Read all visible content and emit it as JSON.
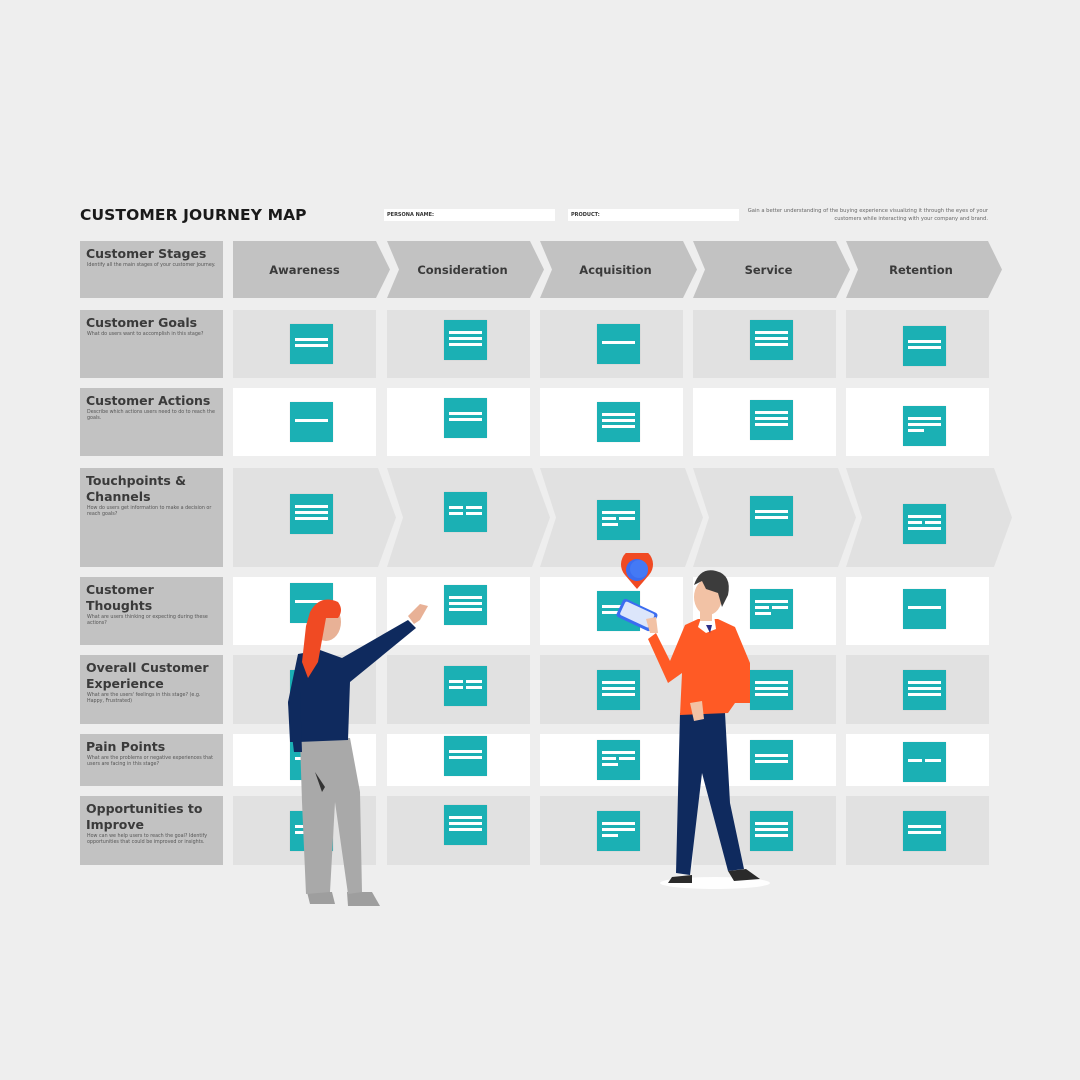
{
  "header": {
    "title": "CUSTOMER JOURNEY MAP",
    "persona_label": "PERSONA NAME:",
    "persona_value": "",
    "product_label": "PRODUCT:",
    "product_value": "",
    "intro": "Gain a better understanding of the buying experience visualizing it through the eyes of your customers while interacting with your company and brand."
  },
  "colors": {
    "note": "#1bb0b4",
    "label_bg": "#c2c2c2",
    "cell_gray": "#e1e1e1",
    "cell_white": "#ffffff",
    "page_bg": "#eeeeee"
  },
  "stages": [
    "Awareness",
    "Consideration",
    "Acquisition",
    "Service",
    "Retention"
  ],
  "rows": [
    {
      "label": "Customer Stages",
      "desc": "Identify all the main stages of your customer journey."
    },
    {
      "label": "Customer Goals",
      "desc": "What do users want to accomplish in this stage?"
    },
    {
      "label": "Customer Actions",
      "desc": "Describe which actions users need to do to reach the goals."
    },
    {
      "label": "Touchpoints & Channels",
      "desc": "How do users get information to make a decision or reach goals?"
    },
    {
      "label": "Customer Thoughts",
      "desc": "What are users thinking or expecting during these actions?"
    },
    {
      "label": "Overall Customer Experience",
      "desc": "What are the users' feelings in this stage? (e.g. Happy, Frustrated)"
    },
    {
      "label": "Pain Points",
      "desc": "What are the problems or negative experiences that users are facing in this stage?"
    },
    {
      "label": "Opportunities to Improve",
      "desc": "How can we help users to reach the goal? Identify opportunities that could be improved or insights."
    }
  ],
  "illustration": {
    "people": [
      "woman-pointing",
      "man-with-phone"
    ],
    "pin_icon": "map-pin-icon"
  }
}
